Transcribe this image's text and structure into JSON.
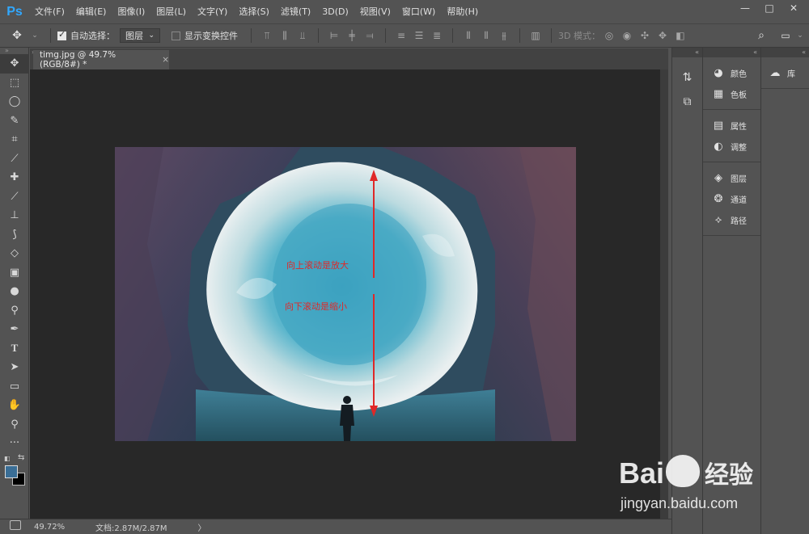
{
  "app": {
    "logo": "Ps",
    "accent": "#31a8ff"
  },
  "menu": [
    "文件(F)",
    "编辑(E)",
    "图像(I)",
    "图层(L)",
    "文字(Y)",
    "选择(S)",
    "滤镜(T)",
    "3D(D)",
    "视图(V)",
    "窗口(W)",
    "帮助(H)"
  ],
  "window_controls": {
    "minimize": "—",
    "maximize": "□",
    "close": "✕"
  },
  "options": {
    "auto_select_label": "自动选择：",
    "auto_select_checked": true,
    "auto_select_target": "图层",
    "show_transform_label": "显示变换控件",
    "show_transform_checked": false,
    "mode_3d_label": "3D 模式："
  },
  "document": {
    "tab_title": "timg.jpg @ 49.7%(RGB/8#) *",
    "close": "×"
  },
  "annotations": {
    "up_text": "向上滚动是放大",
    "down_text": "向下滚动是缩小",
    "color": "#e02828"
  },
  "status": {
    "zoom": "49.72%",
    "doc_info": "文档:2.87M/2.87M",
    "arrow": "〉"
  },
  "panels": {
    "group1": [
      {
        "icon": "palette-icon",
        "label": "颜色"
      },
      {
        "icon": "swatches-icon",
        "label": "色板"
      }
    ],
    "group2": [
      {
        "icon": "properties-icon",
        "label": "属性"
      },
      {
        "icon": "adjustments-icon",
        "label": "调整"
      }
    ],
    "group3": [
      {
        "icon": "layers-icon",
        "label": "图层"
      },
      {
        "icon": "channels-icon",
        "label": "通道"
      },
      {
        "icon": "paths-icon",
        "label": "路径"
      }
    ],
    "library": {
      "icon": "cc-libraries-icon",
      "label": "库"
    }
  },
  "watermark": {
    "brand": "Bai",
    "brand2": "经验",
    "url": "jingyan.baidu.com"
  },
  "colors": {
    "foreground": "#3a6e96",
    "background": "#000000"
  }
}
